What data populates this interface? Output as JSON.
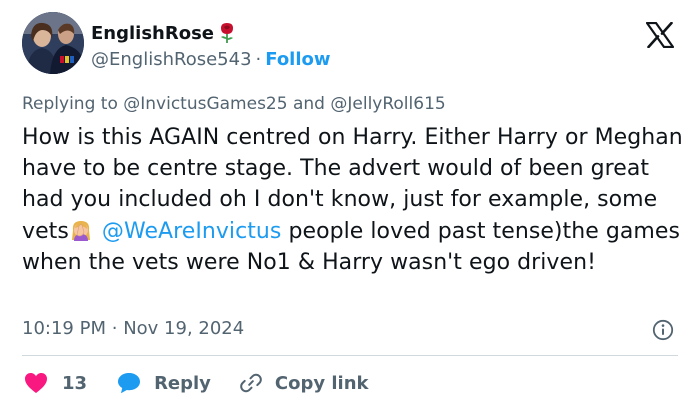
{
  "author": {
    "display_name": "EnglishRose",
    "handle": "@EnglishRose543",
    "separator": "·",
    "follow_label": "Follow",
    "avatar_icon": "user-avatar",
    "name_emoji": "rose-icon"
  },
  "reply_context": {
    "prefix": "Replying to",
    "mention_1": "@InvictusGames25",
    "conjunction": "and",
    "mention_2": "@JellyRoll615"
  },
  "tweet": {
    "text_part1": "How is this AGAIN centred on Harry. Either Harry or Meghan have to be centre stage. The advert would of been great had you included oh I don't know, just for example, some vets",
    "emoji": "woman-facepalming-icon",
    "link": "@WeAreInvictus",
    "text_part2": "people loved past tense)the games when the vets were No1 & Harry wasn't ego driven!"
  },
  "meta": {
    "time": "10:19 PM",
    "separator": "·",
    "date": "Nov 19, 2024",
    "info_icon": "info-icon"
  },
  "actions": {
    "like_count": "13",
    "reply_label": "Reply",
    "copy_label": "Copy link"
  },
  "colors": {
    "accent": "#1d9bf0",
    "like": "#f91880",
    "muted": "#536471",
    "text": "#0f1419",
    "divider": "#cfd9de"
  }
}
